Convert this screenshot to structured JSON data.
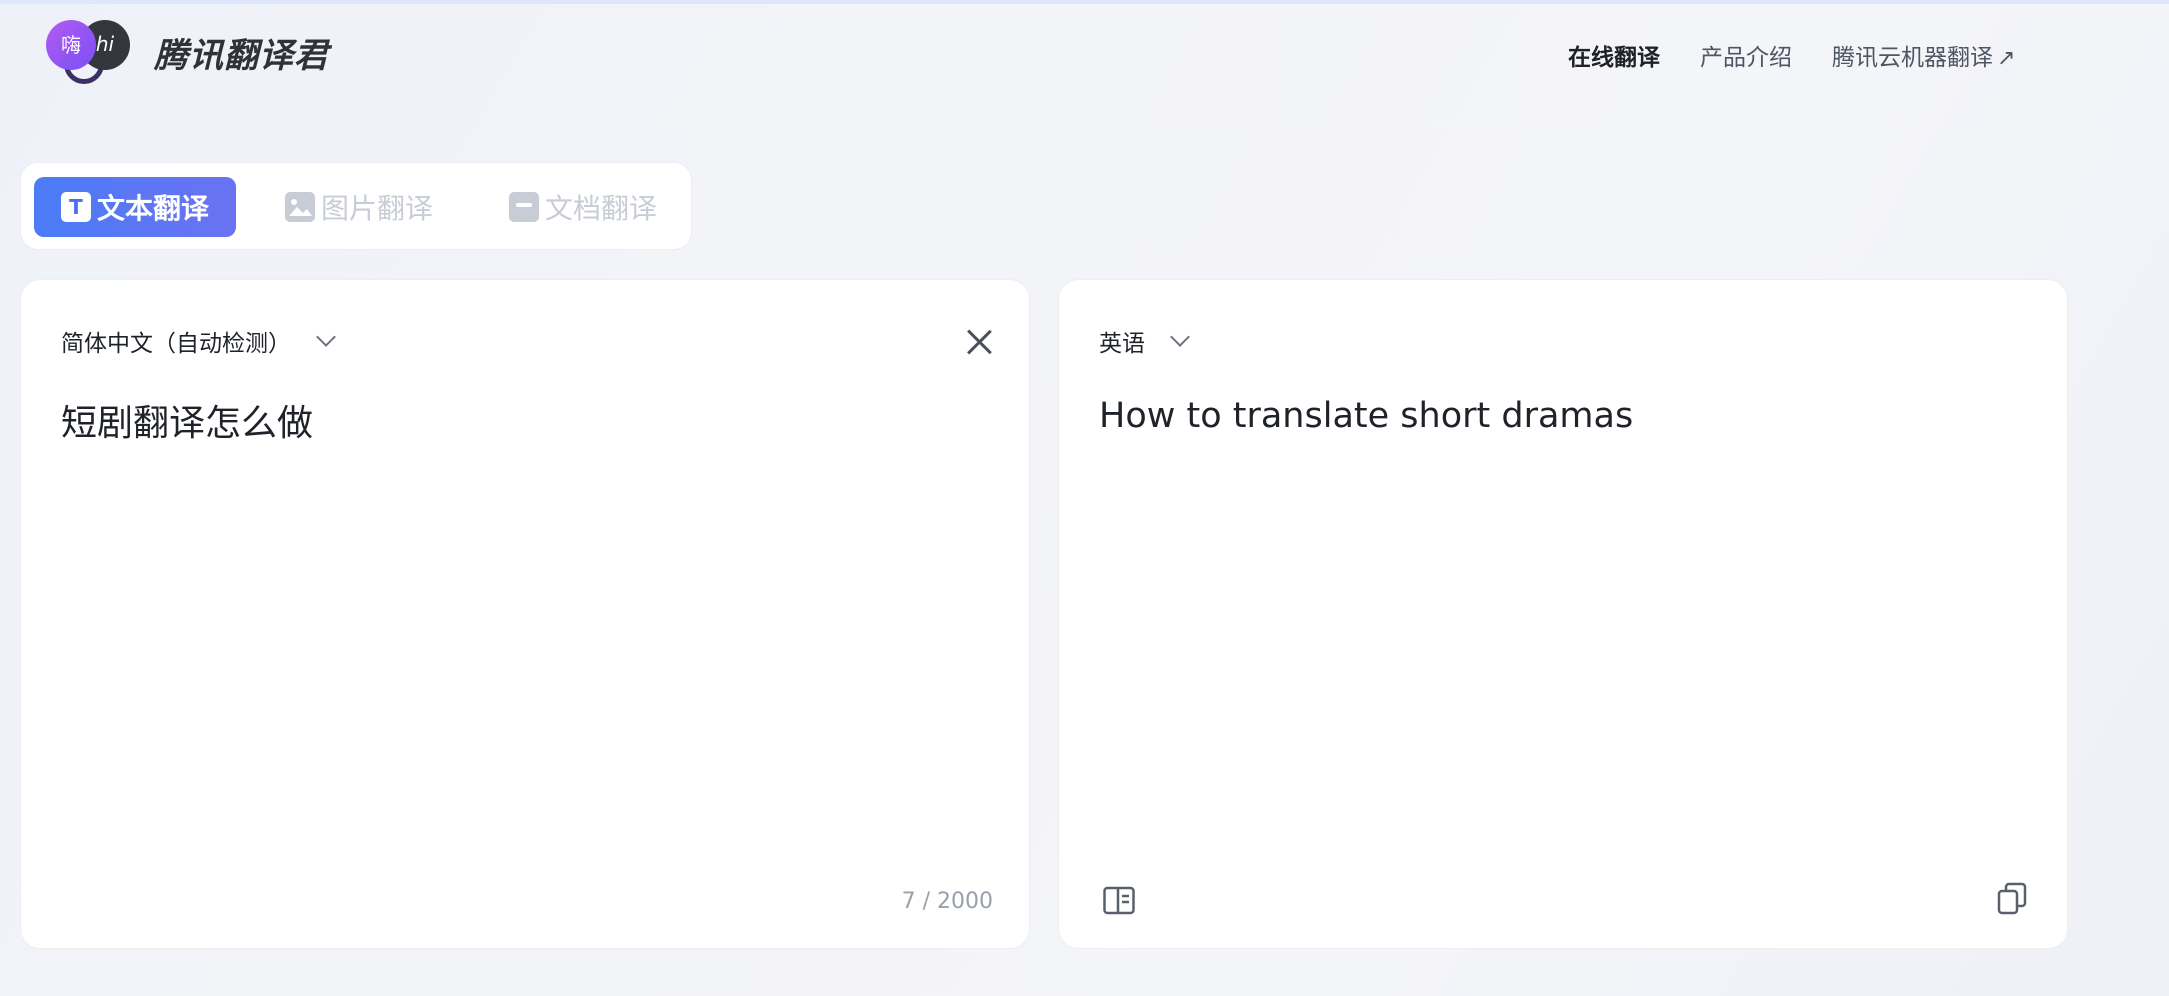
{
  "brand": {
    "name": "腾讯翻译君",
    "logo_left_glyph": "嗨",
    "logo_right_glyph": "hi"
  },
  "nav": {
    "online": "在线翻译",
    "product": "产品介绍",
    "cloud": "腾讯云机器翻译",
    "cloud_arrow": "↗"
  },
  "modes": {
    "text": "文本翻译",
    "text_icon_glyph": "T",
    "image": "图片翻译",
    "doc": "文档翻译"
  },
  "source": {
    "language": "简体中文（自动检测）",
    "text": "短剧翻译怎么做",
    "counter": "7 / 2000"
  },
  "target": {
    "language": "英语",
    "text": "How to translate short dramas"
  },
  "colors": {
    "accent": "#4b7cf6",
    "accent_end": "#6a72f2",
    "muted": "#c8ccd6"
  },
  "icons": [
    "close-icon",
    "chevron-down-icon",
    "compare-icon",
    "copy-icon",
    "image-icon",
    "document-icon",
    "text-icon",
    "external-link-icon"
  ]
}
